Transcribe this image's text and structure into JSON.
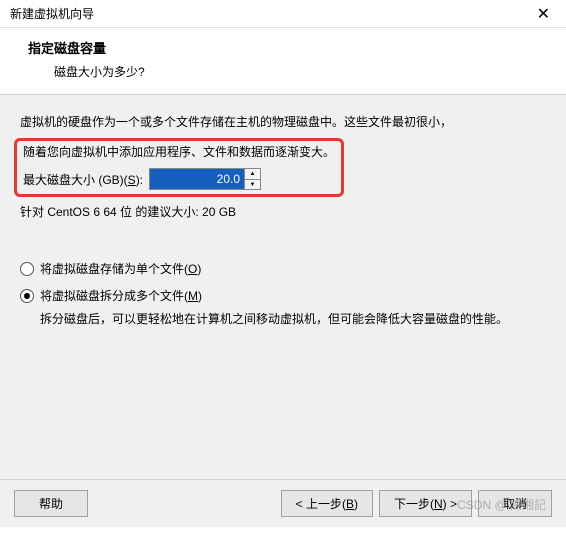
{
  "titlebar": {
    "title": "新建虚拟机向导"
  },
  "header": {
    "title": "指定磁盘容量",
    "subtitle": "磁盘大小为多少?"
  },
  "body": {
    "desc1": "虚拟机的硬盘作为一个或多个文件存储在主机的物理磁盘中。这些文件最初很小，",
    "desc2": "随着您向虚拟机中添加应用程序、文件和数据而逐渐变大。",
    "size_label_pre": "最大磁盘大小 (GB)(",
    "size_label_key": "S",
    "size_label_post": "):",
    "size_value": "20.0",
    "recommendation": "针对 CentOS 6 64 位 的建议大小: 20 GB"
  },
  "radios": {
    "single_pre": "将虚拟磁盘存储为单个文件(",
    "single_key": "O",
    "single_post": ")",
    "split_pre": "将虚拟磁盘拆分成多个文件(",
    "split_key": "M",
    "split_post": ")",
    "split_desc": "拆分磁盘后，可以更轻松地在计算机之间移动虚拟机，但可能会降低大容量磁盘的性能。"
  },
  "footer": {
    "help": "帮助",
    "back_pre": "< 上一步(",
    "back_key": "B",
    "back_post": ")",
    "next_pre": "下一步(",
    "next_key": "N",
    "next_post": ") >",
    "cancel": "取消"
  },
  "watermark": "CSDN @ 陳湘記"
}
